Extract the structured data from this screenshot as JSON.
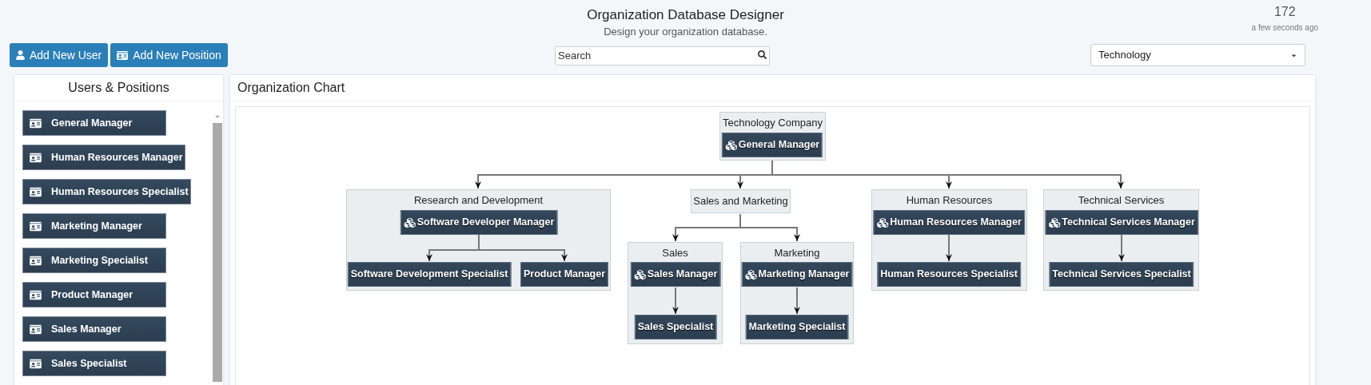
{
  "header": {
    "title": "Organization Database Designer",
    "subtitle": "Design your organization database.",
    "count": "172",
    "updated": "a few seconds ago"
  },
  "toolbar": {
    "buttons": [
      {
        "label": "Add New User",
        "kind": "user"
      },
      {
        "label": "Add New Position",
        "kind": "position"
      }
    ],
    "search": {
      "placeholder": "Search"
    },
    "select": {
      "value": "Technology"
    }
  },
  "users_positions": {
    "title": "Users & Positions",
    "items": [
      {
        "label": "General Manager"
      },
      {
        "label": "Human Resources Manager"
      },
      {
        "label": "Human Resources Specialist"
      },
      {
        "label": "Marketing Manager"
      },
      {
        "label": "Marketing Specialist"
      },
      {
        "label": "Product Manager"
      },
      {
        "label": "Sales Manager"
      },
      {
        "label": "Sales Specialist"
      }
    ]
  },
  "org_chart": {
    "title": "Organization Chart",
    "root": {
      "title": "Technology Company",
      "manager": "General Manager",
      "children": [
        {
          "title": "Research and Development",
          "manager": "Software Developer Manager",
          "positions": [
            "Software Development Specialist",
            "Product Manager"
          ]
        },
        {
          "title": "Sales and Marketing",
          "children": [
            {
              "title": "Sales",
              "manager": "Sales Manager",
              "positions": [
                "Sales Specialist"
              ]
            },
            {
              "title": "Marketing",
              "manager": "Marketing Manager",
              "positions": [
                "Marketing Specialist"
              ]
            }
          ]
        },
        {
          "title": "Human Resources",
          "manager": "Human Resources Manager",
          "positions": [
            "Human Resources Specialist"
          ]
        },
        {
          "title": "Technical Services",
          "manager": "Technical Services Manager",
          "positions": [
            "Technical Services Specialist"
          ]
        }
      ]
    }
  }
}
